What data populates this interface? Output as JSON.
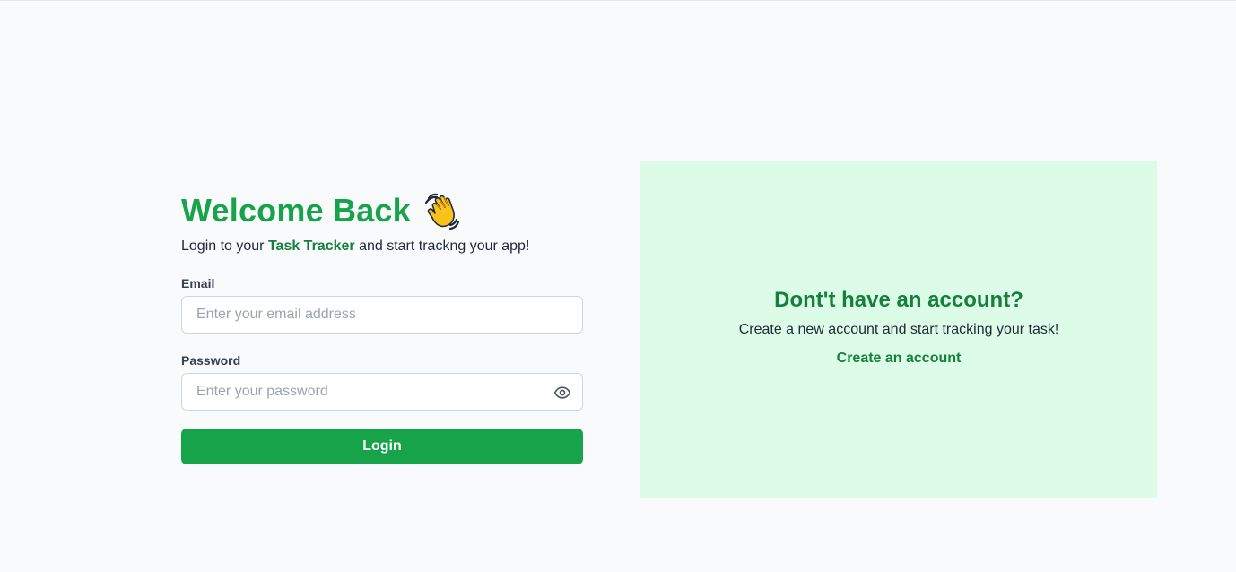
{
  "login": {
    "title": "Welcome Back",
    "wave_icon": "waving-hand-icon",
    "subtitle_prefix": "Login to your ",
    "subtitle_brand": "Task Tracker",
    "subtitle_suffix": " and start trackng your app!",
    "email": {
      "label": "Email",
      "placeholder": "Enter your email address",
      "value": ""
    },
    "password": {
      "label": "Password",
      "placeholder": "Enter your password",
      "value": "",
      "toggle_icon": "eye-icon"
    },
    "submit_label": "Login"
  },
  "signup": {
    "title": "Dont't have an account?",
    "text": "Create a new account and start tracking your task!",
    "link_label": "Create an account"
  },
  "colors": {
    "primary": "#16a34a",
    "primary_dark": "#15803d",
    "panel_bg": "#dcfce7",
    "page_bg": "#f9fafb"
  }
}
